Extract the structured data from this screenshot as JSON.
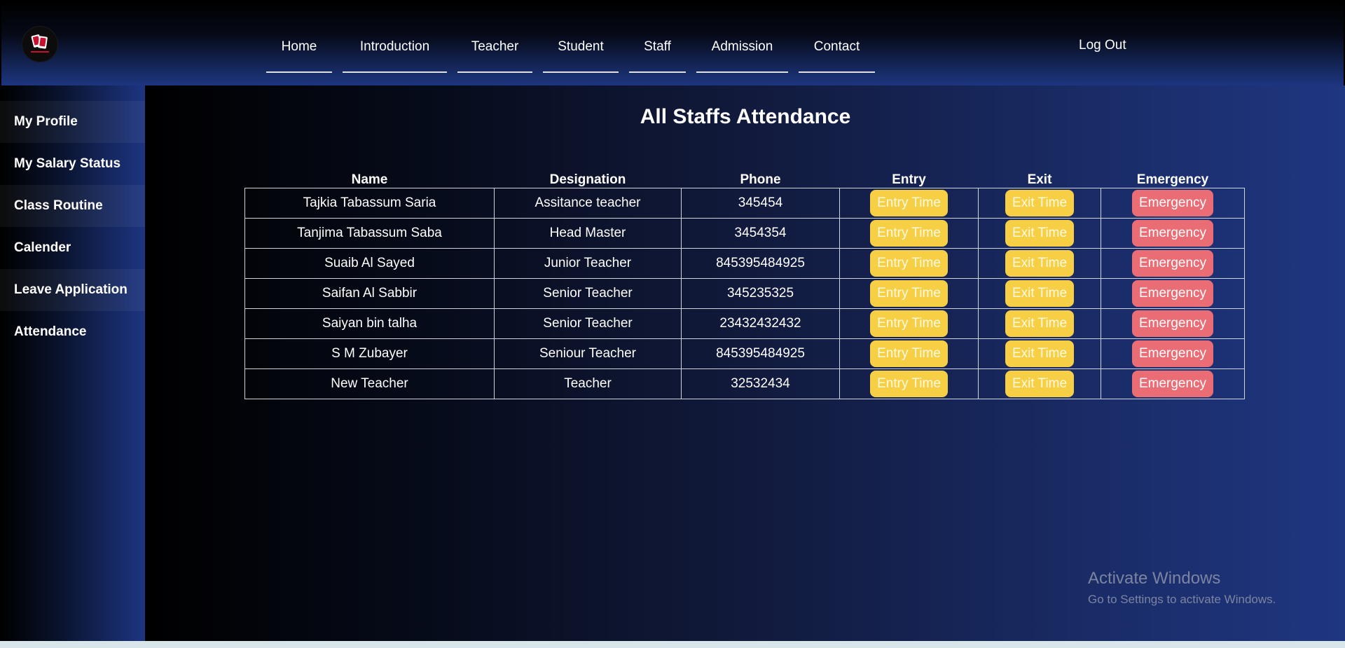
{
  "header": {
    "logo_icon": "school-logo-icon",
    "nav": [
      "Home",
      "Introduction",
      "Teacher",
      "Student",
      "Staff",
      "Admission",
      "Contact"
    ],
    "logout": "Log Out"
  },
  "sidebar": {
    "items": [
      {
        "label": "My Profile"
      },
      {
        "label": "My Salary Status"
      },
      {
        "label": "Class Routine"
      },
      {
        "label": "Calender"
      },
      {
        "label": "Leave Application"
      },
      {
        "label": "Attendance"
      }
    ]
  },
  "main": {
    "title": "All Staffs Attendance",
    "columns": [
      "Name",
      "Designation",
      "Phone",
      "Entry",
      "Exit",
      "Emergency"
    ],
    "rows": [
      {
        "name": "Tajkia Tabassum Saria",
        "designation": "Assitance teacher",
        "phone": "345454"
      },
      {
        "name": "Tanjima Tabassum Saba",
        "designation": "Head Master",
        "phone": "3454354"
      },
      {
        "name": "Suaib Al Sayed",
        "designation": "Junior Teacher",
        "phone": "845395484925"
      },
      {
        "name": "Saifan Al Sabbir",
        "designation": "Senior Teacher",
        "phone": "345235325"
      },
      {
        "name": "Saiyan bin talha",
        "designation": "Senior Teacher",
        "phone": "23432432432"
      },
      {
        "name": "S M Zubayer",
        "designation": "Seniour Teacher",
        "phone": "845395484925"
      },
      {
        "name": "New Teacher",
        "designation": "Teacher",
        "phone": "32532434"
      }
    ],
    "buttons": {
      "entry": "Entry Time",
      "exit": "Exit Time",
      "emergency": "Emergency"
    }
  },
  "watermark": {
    "title": "Activate Windows",
    "subtitle": "Go to Settings to activate Windows."
  },
  "colors": {
    "entry_button": "#f7cf45",
    "exit_button": "#f7cf45",
    "emergency_button": "#ea6c75"
  }
}
